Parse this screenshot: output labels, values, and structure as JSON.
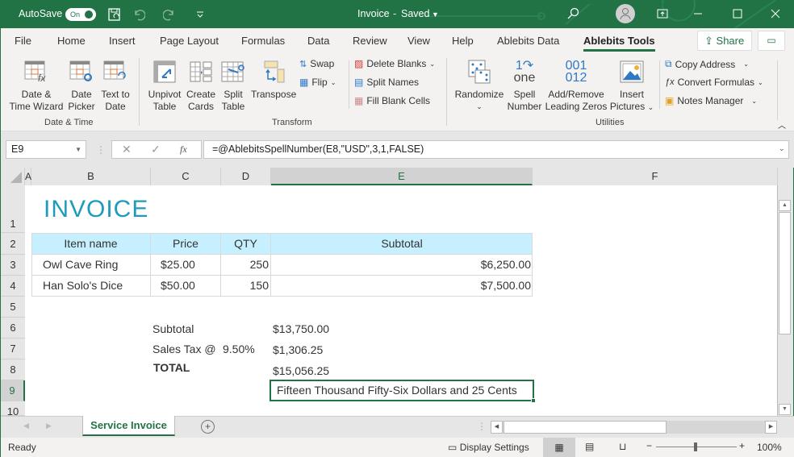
{
  "titlebar": {
    "autosave_label": "AutoSave",
    "autosave_state": "On",
    "doc_title": "Invoice",
    "separator": "-",
    "save_state": "Saved",
    "icons": [
      "save-icon",
      "undo-icon",
      "redo-icon",
      "customize-qat-icon",
      "search-icon",
      "account-icon",
      "ribbon-display-icon",
      "minimize-icon",
      "maximize-icon",
      "close-icon"
    ]
  },
  "tabs": [
    {
      "label": "File"
    },
    {
      "label": "Home"
    },
    {
      "label": "Insert"
    },
    {
      "label": "Page Layout"
    },
    {
      "label": "Formulas"
    },
    {
      "label": "Data"
    },
    {
      "label": "Review"
    },
    {
      "label": "View"
    },
    {
      "label": "Help"
    },
    {
      "label": "Ablebits Data"
    },
    {
      "label": "Ablebits Tools",
      "active": true
    }
  ],
  "share_label": "Share",
  "ribbon": {
    "groups": [
      {
        "name": "Date & Time",
        "buttons": [
          {
            "label1": "Date &",
            "label2": "Time Wizard"
          },
          {
            "label1": "Date",
            "label2": "Picker"
          },
          {
            "label1": "Text to",
            "label2": "Date"
          }
        ]
      },
      {
        "name": "Transform",
        "buttons": [
          {
            "label1": "Unpivot",
            "label2": "Table"
          },
          {
            "label1": "Create",
            "label2": "Cards"
          },
          {
            "label1": "Split",
            "label2": "Table"
          },
          {
            "label1": "Transpose",
            "label2": ""
          }
        ],
        "small": [
          {
            "label": "Swap"
          },
          {
            "label": "Flip"
          },
          {
            "label": "Delete Blanks"
          },
          {
            "label": "Split Names"
          },
          {
            "label": "Fill Blank Cells"
          }
        ]
      },
      {
        "name": "Utilities",
        "buttons": [
          {
            "label1": "Randomize",
            "label2": ""
          },
          {
            "label1": "Spell",
            "label2": "Number"
          },
          {
            "label1": "Add/Remove",
            "label2": "Leading Zeros"
          },
          {
            "label1": "Insert",
            "label2": "Pictures"
          }
        ],
        "small": [
          {
            "label": "Copy Address"
          },
          {
            "label": "Convert Formulas"
          },
          {
            "label": "Notes Manager"
          }
        ]
      }
    ]
  },
  "formula_bar": {
    "name_box": "E9",
    "formula": "=@AblebitsSpellNumber(E8,\"USD\",3,1,FALSE)"
  },
  "columns": [
    "A",
    "B",
    "C",
    "D",
    "E",
    "F"
  ],
  "rows": [
    "1",
    "2",
    "3",
    "4",
    "5",
    "6",
    "7",
    "8",
    "9",
    "10"
  ],
  "sheet": {
    "title": "INVOICE",
    "table_headers": [
      "Item name",
      "Price",
      "QTY",
      "Subtotal"
    ],
    "table_rows": [
      {
        "item": "Owl Cave Ring",
        "price": "$25.00",
        "qty": "250",
        "subtotal": "$6,250.00"
      },
      {
        "item": "Han Solo's Dice",
        "price": "$50.00",
        "qty": "150",
        "subtotal": "$7,500.00"
      }
    ],
    "subtotal_label": "Subtotal",
    "subtotal_value": "$13,750.00",
    "tax_label": "Sales Tax @",
    "tax_rate": "9.50%",
    "tax_value": "$1,306.25",
    "total_label": "TOTAL",
    "total_value": "$15,056.25",
    "spelled_total": "Fifteen Thousand Fifty-Six Dollars and 25 Cents"
  },
  "sheet_tabs": [
    {
      "label": "Service Invoice",
      "active": true
    }
  ],
  "status": {
    "mode": "Ready",
    "display_settings": "Display Settings",
    "zoom": "100%"
  },
  "colors": {
    "accent": "#217346",
    "header_fill": "#c6efff",
    "title": "#1e9bbb"
  }
}
